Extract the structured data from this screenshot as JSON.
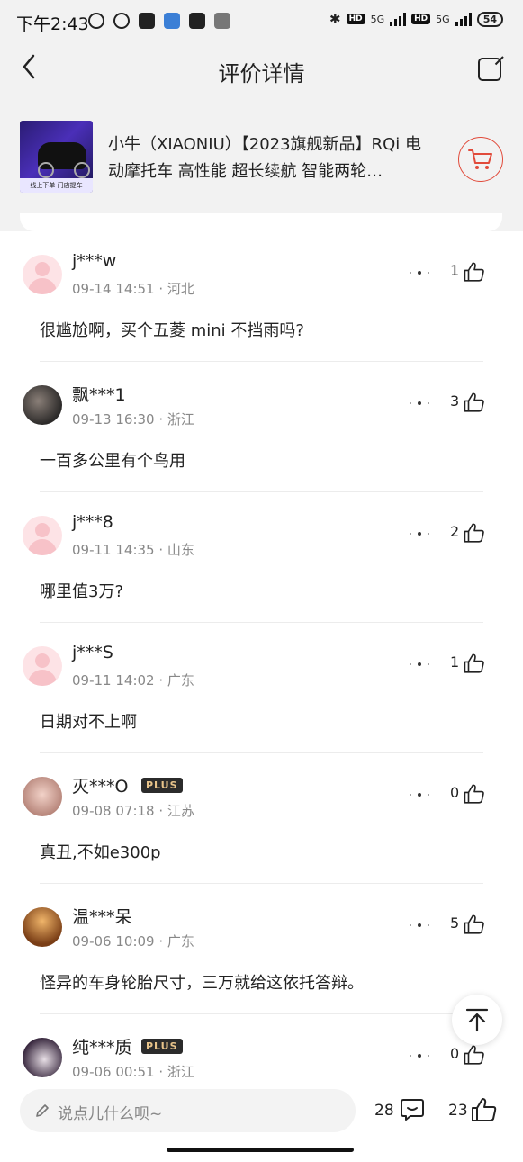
{
  "status_bar": {
    "time": "下午2:43",
    "network": "5G",
    "battery": "54"
  },
  "header": {
    "title": "评价详情"
  },
  "product": {
    "title": "小牛（XIAONIU）【2023旗舰新品】RQi 电动摩托车 高性能 超长续航 智能两轮…",
    "thumb_caption": "线上下单 门店提车"
  },
  "comments": [
    {
      "user": "j***w",
      "date": "09-14 14:51 · 河北",
      "likes": "1",
      "text": "很尴尬啊，买个五菱 mini 不挡雨吗?",
      "plus": false
    },
    {
      "user": "飘***1",
      "date": "09-13 16:30 · 浙江",
      "likes": "3",
      "text": "一百多公里有个鸟用",
      "plus": false
    },
    {
      "user": "j***8",
      "date": "09-11 14:35 · 山东",
      "likes": "2",
      "text": "哪里值3万?",
      "plus": false
    },
    {
      "user": "j***S",
      "date": "09-11 14:02 · 广东",
      "likes": "1",
      "text": "日期对不上啊",
      "plus": false
    },
    {
      "user": "灭***O",
      "date": "09-08 07:18 · 江苏",
      "likes": "0",
      "text": "真丑,不如e300p",
      "plus": true,
      "plus_label": "PLUS"
    },
    {
      "user": "温***呆",
      "date": "09-06 10:09 · 广东",
      "likes": "5",
      "text": "怪异的车身轮胎尺寸，三万就给这依托答辩。",
      "plus": false
    },
    {
      "user": "纯***质",
      "date": "09-06 00:51 · 浙江",
      "likes": "0",
      "text": "",
      "plus": true,
      "plus_label": "PLUS"
    }
  ],
  "bottom_bar": {
    "input_placeholder": "说点儿什么呗~",
    "comment_count": "28",
    "like_count": "23"
  },
  "colors": {
    "accent": "#e14b3b",
    "background": "#f2f2f2",
    "plus_badge_bg": "#2b2b2b",
    "plus_badge_text": "#e7c38a"
  }
}
